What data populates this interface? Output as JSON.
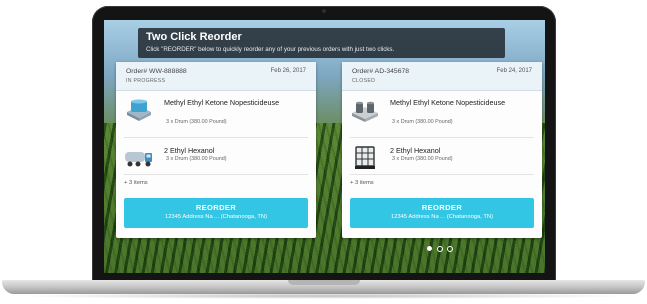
{
  "header": {
    "title": "Two Click Reorder",
    "subtitle": "Click \"REORDER\" below to quickly reorder any of your previous orders with just two clicks."
  },
  "orders": [
    {
      "order_no": "Order#  WW-888888",
      "date": "Feb 26, 2017",
      "status": "IN PROGRESS",
      "items": [
        {
          "name": "Methyl Ethyl Ketone Nopesticideuse",
          "qty": "3 x Drum (380.00 Pound)",
          "icon": "drum-pallet-icon"
        },
        {
          "name": "2 Ethyl Hexanol",
          "qty": "3 x Drum (380.00 Pound)",
          "icon": "tanker-truck-icon"
        }
      ],
      "more": "+ 3 items",
      "reorder_label": "REORDER",
      "address": "12345 Address Na ... (Chatanooga, TN)"
    },
    {
      "order_no": "Order# AD-345678",
      "date": "Feb 24, 2017",
      "status": "CLOSED",
      "items": [
        {
          "name": "Methyl Ethyl Ketone Nopesticideuse",
          "qty": "3 x Drum (380.00 Pound)",
          "icon": "barrel-pallet-icon"
        },
        {
          "name": "2 Ethyl Hexanol",
          "qty": "3 x Drum (380.00 Pound)",
          "icon": "tote-container-icon"
        }
      ],
      "more": "+ 3 items",
      "reorder_label": "REORDER",
      "address": "12345 Address Na ... (Chatanooga, TN)"
    }
  ],
  "carousel": {
    "pages": 3,
    "active_index": 0
  },
  "colors": {
    "accent": "#33c6e4",
    "header_bg": "#1c2228",
    "card_head_bg": "#eaf3f8"
  }
}
